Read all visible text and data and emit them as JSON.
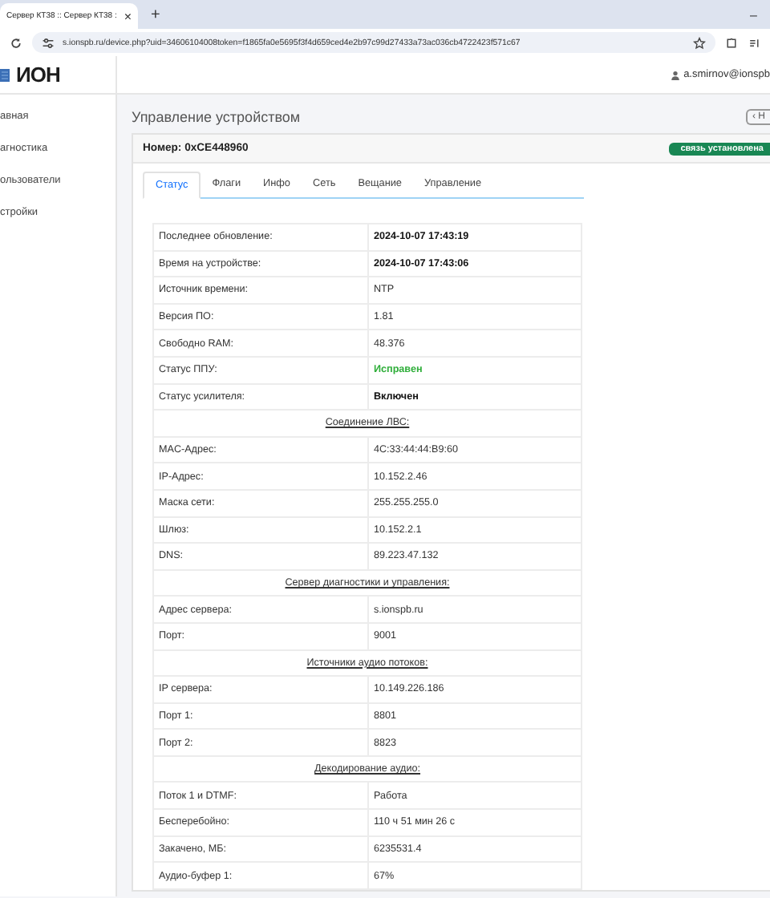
{
  "browser": {
    "tab_title": "Сервер КТ38 :: Сервер КТ38 :",
    "tab_close": "×",
    "new_tab": "+",
    "minimize": "–",
    "url": "s.ionspb.ru/device.php?uid=34606104008token=f1865fa0e5695f3f4d659ced4e2b97c99d27433a73ac036cb4722423f571c67"
  },
  "header": {
    "logo": "ИОН",
    "user": "a.smirnov@ionspb"
  },
  "sidebar": {
    "items": [
      {
        "label": "авная",
        "selected": false
      },
      {
        "label": "агностика",
        "selected": false
      },
      {
        "label": "ользователи",
        "selected": false
      },
      {
        "label": "стройки",
        "selected": false
      }
    ]
  },
  "page_title": "Управление устройством",
  "back_button": "‹ Н",
  "device": {
    "number": "Номер: 0xCE448960",
    "status": "связь установлена"
  },
  "tabs": [
    {
      "label": "Статус",
      "selected": true
    },
    {
      "label": "Флаги",
      "selected": false
    },
    {
      "label": "Инфо",
      "selected": false
    },
    {
      "label": "Сеть",
      "selected": false
    },
    {
      "label": "Вещание",
      "selected": false
    },
    {
      "label": "Управление",
      "selected": false
    }
  ],
  "table": {
    "rows": [
      {
        "kind": "bold",
        "label": "Последнее обновление:",
        "value": "2024-10-07 17:43:19"
      },
      {
        "kind": "bold",
        "label": "Время на устройстве:",
        "value": "2024-10-07 17:43:06"
      },
      {
        "kind": "pair",
        "label": "Источник времени:",
        "value": "NTP"
      },
      {
        "kind": "pair",
        "label": "Версия ПО:",
        "value": "1.81"
      },
      {
        "kind": "pair",
        "label": "Свободно RAM:",
        "value": "48.376"
      },
      {
        "kind": "ok",
        "label": "Статус ППУ:",
        "value": "Исправен"
      },
      {
        "kind": "bold",
        "label": "Статус усилителя:",
        "value": "Включен"
      },
      {
        "kind": "section",
        "label": "Соединение ЛВС:"
      },
      {
        "kind": "pair",
        "label": "MAC-Адрес:",
        "value": "4C:33:44:44:B9:60"
      },
      {
        "kind": "pair",
        "label": "IP-Адрес:",
        "value": "10.152.2.46"
      },
      {
        "kind": "pair",
        "label": "Маска сети:",
        "value": "255.255.255.0"
      },
      {
        "kind": "pair",
        "label": "Шлюз:",
        "value": "10.152.2.1"
      },
      {
        "kind": "pair",
        "label": "DNS:",
        "value": "89.223.47.132"
      },
      {
        "kind": "section",
        "label": "Сервер диагностики и управления:"
      },
      {
        "kind": "pair",
        "label": "Адрес сервера:",
        "value": "s.ionspb.ru"
      },
      {
        "kind": "pair",
        "label": "Порт:",
        "value": "9001"
      },
      {
        "kind": "section",
        "label": "Источники аудио потоков:"
      },
      {
        "kind": "pair",
        "label": "IP сервера:",
        "value": "10.149.226.186"
      },
      {
        "kind": "pair",
        "label": "Порт 1:",
        "value": "8801"
      },
      {
        "kind": "pair",
        "label": "Порт 2:",
        "value": "8823"
      },
      {
        "kind": "section",
        "label": "Декодирование аудио:"
      },
      {
        "kind": "pair",
        "label": "Поток 1 и DTMF:",
        "value": "Работа"
      },
      {
        "kind": "pair",
        "label": "Бесперебойно:",
        "value": "110 ч 51 мин 26 с"
      },
      {
        "kind": "pair",
        "label": "Закачено, МБ:",
        "value": "6235531.4"
      },
      {
        "kind": "pair",
        "label": "Аудио-буфер 1:",
        "value": "67%"
      }
    ]
  }
}
